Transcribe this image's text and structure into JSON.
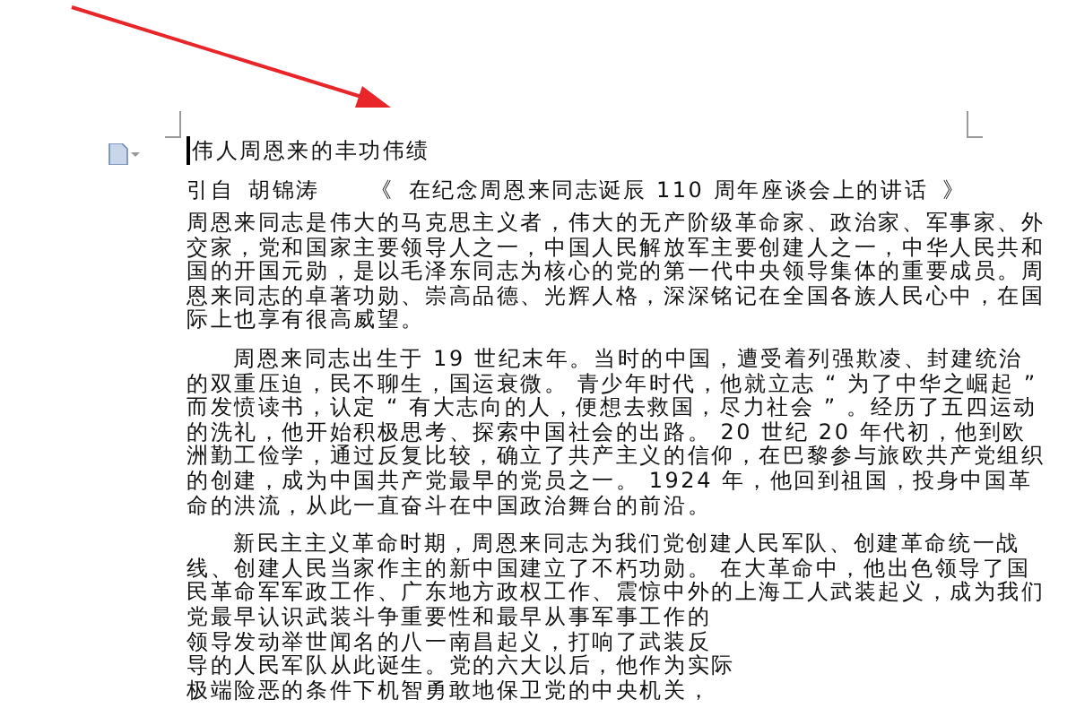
{
  "document": {
    "title": "伟人周恩来的丰功伟绩",
    "source": {
      "label": "引自",
      "author": "胡锦涛",
      "open_quote": "《",
      "work": "在纪念周恩来同志诞辰 110 周年座谈会上的讲话",
      "close_quote": "》"
    },
    "paragraphs": [
      {
        "indent": false,
        "lines": [
          "周恩来同志是伟大的马克思主义者，伟大的无产阶级革命家、政治家、军事家、外",
          "交家，党和国家主要领导人之一，中国人民解放军主要创建人之一，中华人民共和",
          "国的开国元勋，是以毛泽东同志为核心的党的第一代中央领导集体的重要成员。周",
          "恩来同志的卓著功勋、崇高品德、光辉人格，深深铭记在全国各族人民心中，在国",
          "际上也享有很高威望。"
        ]
      },
      {
        "indent": true,
        "lines": [
          "周恩来同志出生于 19  世纪末年。当时的中国，遭受着列强欺凌、封建统治",
          "的双重压迫，民不聊生，国运衰微。 青少年时代，他就立志 “ 为了中华之崛起 ”",
          "而发愤读书，认定 “ 有大志向的人，便想去救国，尽力社会 ” 。经历了五四运动",
          "的洗礼，他开始积极思考、探索中国社会的出路。 20  世纪 20  年代初，他到欧",
          "洲勤工俭学，通过反复比较，确立了共产主义的信仰，在巴黎参与旅欧共产党组织",
          "的创建，成为中国共产党最早的党员之一。 1924  年，他回到祖国，投身中国革",
          "命的洪流，从此一直奋斗在中国政治舞台的前沿。"
        ]
      },
      {
        "indent": true,
        "lines": [
          "新民主主义革命时期，周恩来同志为我们党创建人民军队、创建革命统一战",
          "线、创建人民当家作主的新中国建立了不朽功勋。 在大革命中，他出色领导了国",
          "民革命军军政工作、广东地方政权工作、震惊中外的上海工人武装起义，成为我们",
          "党最早认识武装斗争重要性和最早从事军事工作的",
          "领导发动举世闻名的八一南昌起义，打响了武装反",
          "导的人民军队从此诞生。党的六大以后，他作为实际",
          "极端险恶的条件下机智勇敢地保卫党的中央机关，"
        ]
      }
    ]
  }
}
